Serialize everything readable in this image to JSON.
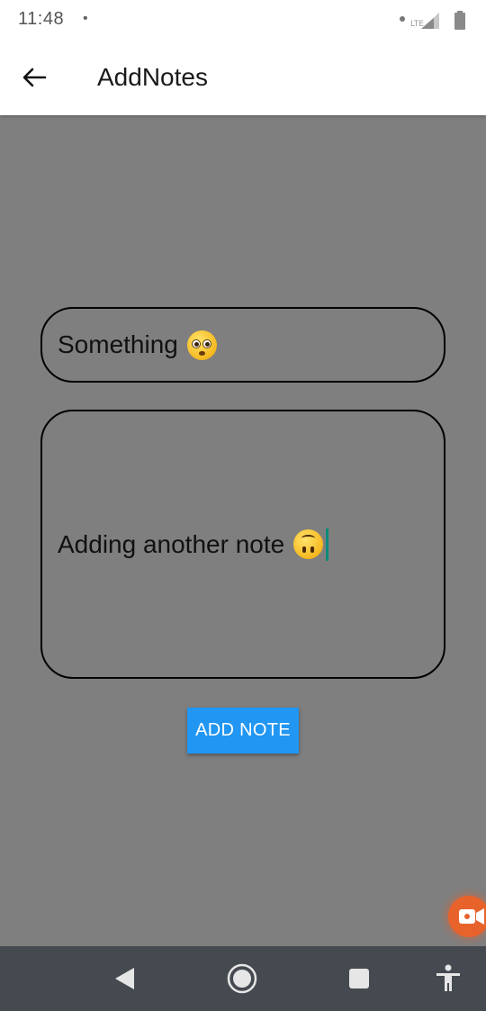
{
  "status_bar": {
    "time": "11:48",
    "notification_dot": "•",
    "network_label": "LTE",
    "battery_level": "59",
    "icons": [
      "signal-icon",
      "battery-icon"
    ]
  },
  "app_bar": {
    "back_icon": "arrow-left-icon",
    "title": "AddNotes"
  },
  "form": {
    "title_value": "Something",
    "title_emoji": "pleading-face",
    "note_value": "Adding another note",
    "note_emoji": "upside-down-face",
    "submit_label": "ADD NOTE"
  },
  "overlay": {
    "record_icon": "video-camera-icon"
  },
  "nav_bar": {
    "icons": [
      "back-triangle-icon",
      "home-circle-icon",
      "recents-square-icon",
      "accessibility-icon"
    ]
  },
  "colors": {
    "background_dim": "#7f7f7f",
    "button_primary": "#2196f3",
    "cursor": "#0f8a7a",
    "record_button": "#e8622c",
    "nav_bar": "#454a50"
  }
}
